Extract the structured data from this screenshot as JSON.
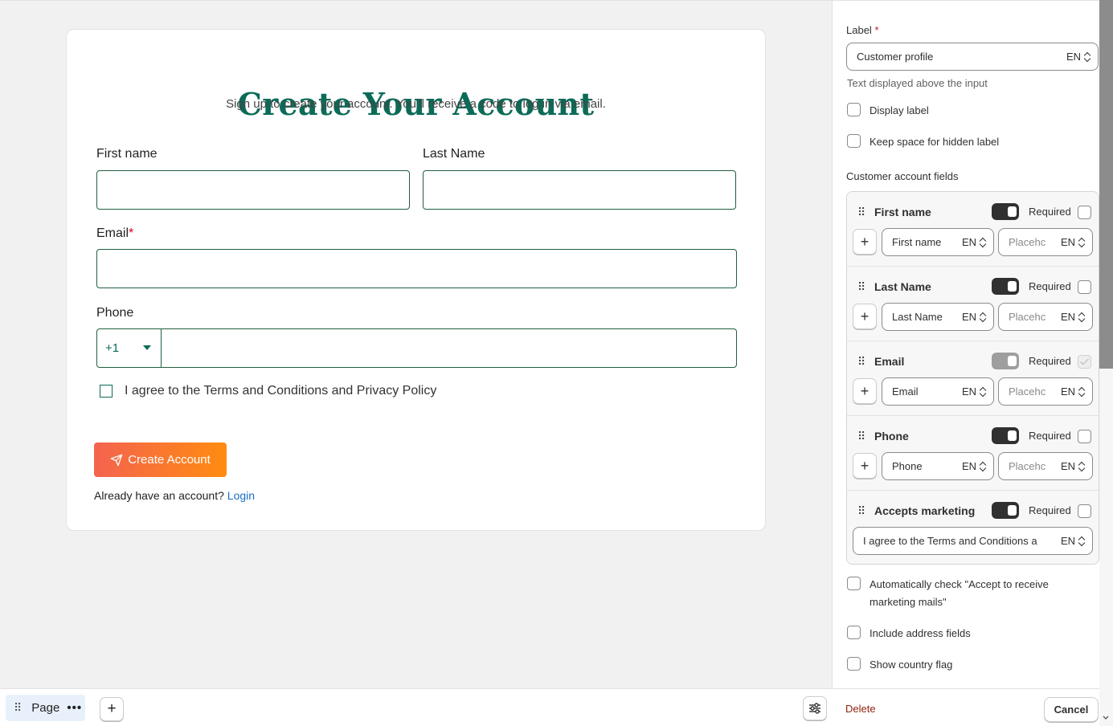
{
  "form": {
    "title": "Create Your Account",
    "subtitle": "Sign up to create your account. You’ll receive a code to log in via email.",
    "first_name_label": "First name",
    "last_name_label": "Last Name",
    "email_label": "Email",
    "email_required_mark": "*",
    "phone_label": "Phone",
    "phone_code": "+1",
    "agree_text": "I agree to the Terms and Conditions and Privacy Policy",
    "create_button": "Create Account",
    "already_text": "Already have an account?",
    "login_link": "Login"
  },
  "bottom_bar": {
    "page_label": "Page",
    "more_glyph": "•••",
    "add_glyph": "+"
  },
  "panel": {
    "label_title": "Label",
    "required_mark": "*",
    "label_value": "Customer profile",
    "lang": "EN",
    "help_text": "Text displayed above the input",
    "display_label": "Display label",
    "keep_space": "Keep space for hidden label",
    "fields_title": "Customer account fields",
    "required_text": "Required",
    "placeholder_text": "Placehc",
    "fields": [
      {
        "name": "First name",
        "value": "First name",
        "enabled": true,
        "required": false
      },
      {
        "name": "Last Name",
        "value": "Last Name",
        "enabled": true,
        "required": false
      },
      {
        "name": "Email",
        "value": "Email",
        "enabled": "disabled",
        "required": "locked"
      },
      {
        "name": "Phone",
        "value": "Phone",
        "enabled": true,
        "required": false
      },
      {
        "name": "Accepts marketing",
        "value": "I agree to the Terms and Conditions a",
        "enabled": true,
        "required": false
      }
    ],
    "auto_check": "Automatically check \"Accept to receive marketing mails\"",
    "include_address": "Include address fields",
    "show_flag": "Show country flag",
    "delete": "Delete",
    "cancel": "Cancel"
  },
  "colors": {
    "brand_green": "#0b6b58",
    "button_gradient_start": "#f4634f",
    "button_gradient_end": "#ff8c10",
    "link_blue": "#1a6fc4",
    "delete_red": "#8e1f0b"
  }
}
